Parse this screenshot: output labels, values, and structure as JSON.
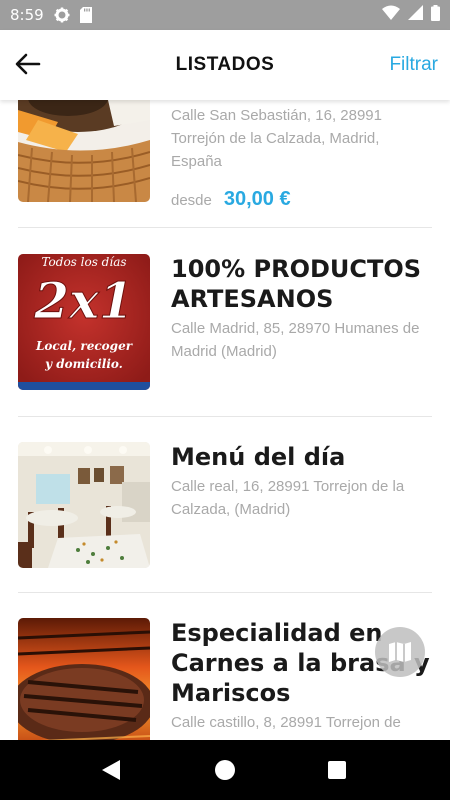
{
  "status_bar": {
    "time": "8:59",
    "icons": [
      "settings-icon",
      "sd-card-icon",
      "wifi-icon",
      "signal-icon",
      "battery-icon"
    ]
  },
  "header": {
    "title": "LISTADOS",
    "filter_label": "Filtrar",
    "back_icon": "arrow-left-icon"
  },
  "listings": [
    {
      "address": "Calle San Sebastián, 16, 28991 Torrejón de la Calzada, Madrid, España",
      "price_prefix": "desde",
      "price": "30,00 €"
    },
    {
      "title": "100% PRODUCTOS ARTESANOS",
      "address": "Calle Madrid, 85, 28970 Humanes de Madrid (Madrid)",
      "image_text": {
        "line1": "Todos los días",
        "line2": "2x1",
        "line3": "Local, recoger",
        "line4": "y domicilio."
      }
    },
    {
      "title": "Menú del día",
      "address": "Calle real, 16, 28991 Torrejon de la Calzada, (Madrid)"
    },
    {
      "title": "Especialidad en Carnes a la brasa y Mariscos",
      "address": "Calle castillo, 8, 28991 Torrejon de"
    }
  ],
  "map_button_icon": "map-icon",
  "nav_bar": {
    "icons": [
      "back-triangle-icon",
      "home-circle-icon",
      "recents-square-icon"
    ]
  },
  "colors": {
    "accent": "#29a9e1",
    "status_bar": "#9e9e9e",
    "text_secondary": "#a9a9a9"
  }
}
